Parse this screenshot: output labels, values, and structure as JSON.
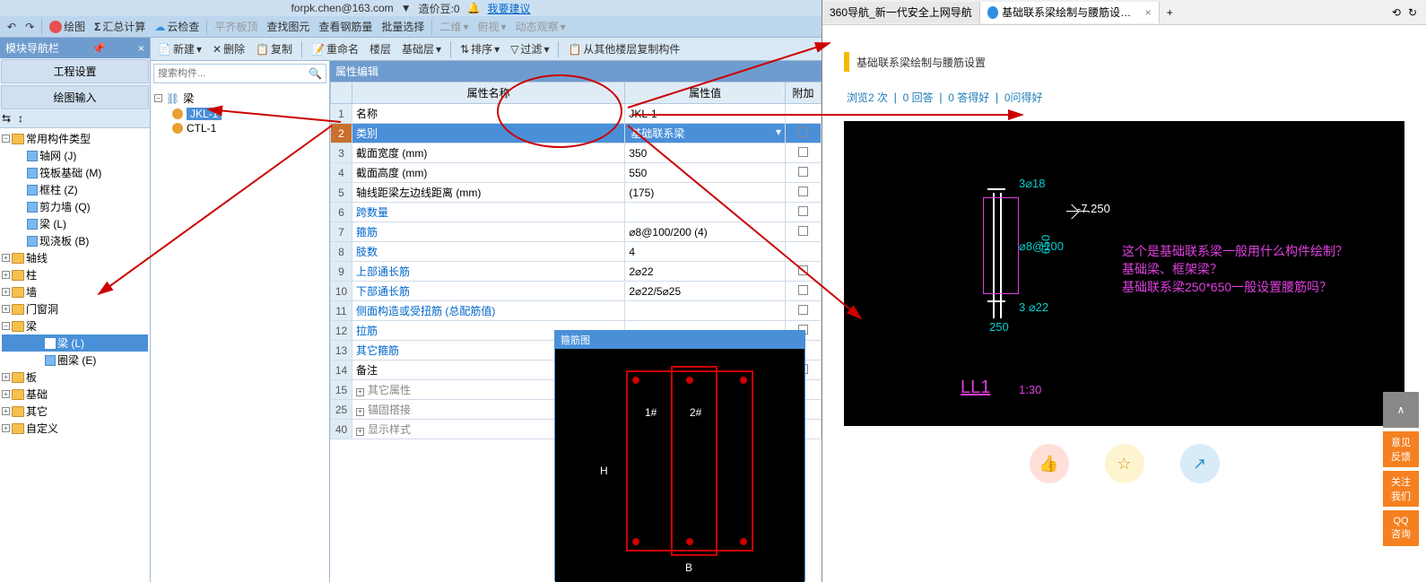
{
  "topinfo": {
    "email": "forpk.chen@163.com",
    "credits_label": "造价豆:0",
    "suggest": "我要建议"
  },
  "toolbar1": {
    "draw": "绘图",
    "sumcalc": "汇总计算",
    "cloudcheck": "云检查",
    "levelboard": "平齐板顶",
    "findgraph": "查找图元",
    "viewrebar": "查看钢筋量",
    "batchsel": "批量选择",
    "dim2": "二维",
    "lookdown": "俯视",
    "dynview": "动态观察"
  },
  "toolbar2": {
    "new": "新建",
    "delete": "删除",
    "copy": "复制",
    "rename": "重命名",
    "floor": "楼层",
    "baselayer": "基础层",
    "sort": "排序",
    "filter": "过滤",
    "copyfrom": "从其他楼层复制构件"
  },
  "nav": {
    "title": "模块导航栏",
    "engset": "工程设置",
    "drawinput": "绘图输入",
    "tree": {
      "common": "常用构件类型",
      "axisnet": "轴网 (J)",
      "raft": "筏板基础 (M)",
      "framecol": "框柱 (Z)",
      "shearwall": "剪力墙 (Q)",
      "beam_l": "梁 (L)",
      "castslab": "现浇板 (B)",
      "axis": "轴线",
      "column": "柱",
      "wall": "墙",
      "opening": "门窗洞",
      "beam": "梁",
      "beam_sub": "梁 (L)",
      "ringbeam": "圈梁 (E)",
      "slab": "板",
      "foundation": "基础",
      "other": "其它",
      "custom": "自定义"
    }
  },
  "search": {
    "placeholder": "搜索构件..."
  },
  "itemtree": {
    "root": "梁",
    "jkl": "JKL-1",
    "ctl": "CTL-1"
  },
  "prop": {
    "title": "属性编辑",
    "col_name": "属性名称",
    "col_value": "属性值",
    "col_extra": "附加",
    "rows": [
      {
        "n": "1",
        "name": "名称",
        "value": "JKL-1",
        "link": false,
        "chk": false
      },
      {
        "n": "2",
        "name": "类别",
        "value": "基础联系梁",
        "link": false,
        "chk": true,
        "sel": true
      },
      {
        "n": "3",
        "name": "截面宽度 (mm)",
        "value": "350",
        "link": false,
        "chk": true
      },
      {
        "n": "4",
        "name": "截面高度 (mm)",
        "value": "550",
        "link": false,
        "chk": true
      },
      {
        "n": "5",
        "name": "轴线距梁左边线距离 (mm)",
        "value": "(175)",
        "link": false,
        "chk": true
      },
      {
        "n": "6",
        "name": "跨数量",
        "value": "",
        "link": true,
        "chk": true
      },
      {
        "n": "7",
        "name": "箍筋",
        "value": "⌀8@100/200 (4)",
        "link": true,
        "chk": true
      },
      {
        "n": "8",
        "name": "肢数",
        "value": "4",
        "link": true,
        "chk": false
      },
      {
        "n": "9",
        "name": "上部通长筋",
        "value": "2⌀22",
        "link": true,
        "chk": true
      },
      {
        "n": "10",
        "name": "下部通长筋",
        "value": "2⌀22/5⌀25",
        "link": true,
        "chk": true
      },
      {
        "n": "11",
        "name": "侧面构造或受扭筋 (总配筋值)",
        "value": "",
        "link": true,
        "chk": true
      },
      {
        "n": "12",
        "name": "拉筋",
        "value": "",
        "link": true,
        "chk": true
      },
      {
        "n": "13",
        "name": "其它箍筋",
        "value": "",
        "link": true,
        "chk": false
      },
      {
        "n": "14",
        "name": "备注",
        "value": "",
        "link": false,
        "chk": true
      },
      {
        "n": "15",
        "name": "其它属性",
        "value": "",
        "link": false,
        "chk": false,
        "exp": true
      },
      {
        "n": "25",
        "name": "锚固搭接",
        "value": "",
        "link": false,
        "chk": false,
        "exp": true
      },
      {
        "n": "40",
        "name": "显示样式",
        "value": "",
        "link": false,
        "chk": false,
        "exp": true
      }
    ]
  },
  "rebar_diagram": {
    "title": "箍筋图",
    "label1": "1#",
    "label2": "2#",
    "labelH": "H",
    "labelB": "B"
  },
  "browser": {
    "tab1": "360导航_新一代安全上网导航",
    "tab2": "基础联系梁绘制与腰筋设置_广联",
    "page_title": "基础联系梁绘制与腰筋设置",
    "stats_browse": "浏览2 次",
    "stats_reply": "0 回答",
    "stats_good": "0 答得好",
    "stats_ask": "0问得好",
    "cad_q1": "这个是基础联系梁一般用什么构件绘制？",
    "cad_q2": "基础梁、框架梁？",
    "cad_q3": "基础联系梁250*650一般设置腰筋吗？",
    "cad_t1": "3⌀18",
    "cad_t2": "-7.250",
    "cad_t3": "⌀8@100",
    "cad_t4": "650",
    "cad_t5": "3 ⌀22",
    "cad_t6": "250",
    "cad_t7": "LL1",
    "cad_t8": "1:30",
    "side_feedback": "意见\n反馈",
    "side_follow": "关注\n我们",
    "side_qq": "QQ\n咨询"
  }
}
